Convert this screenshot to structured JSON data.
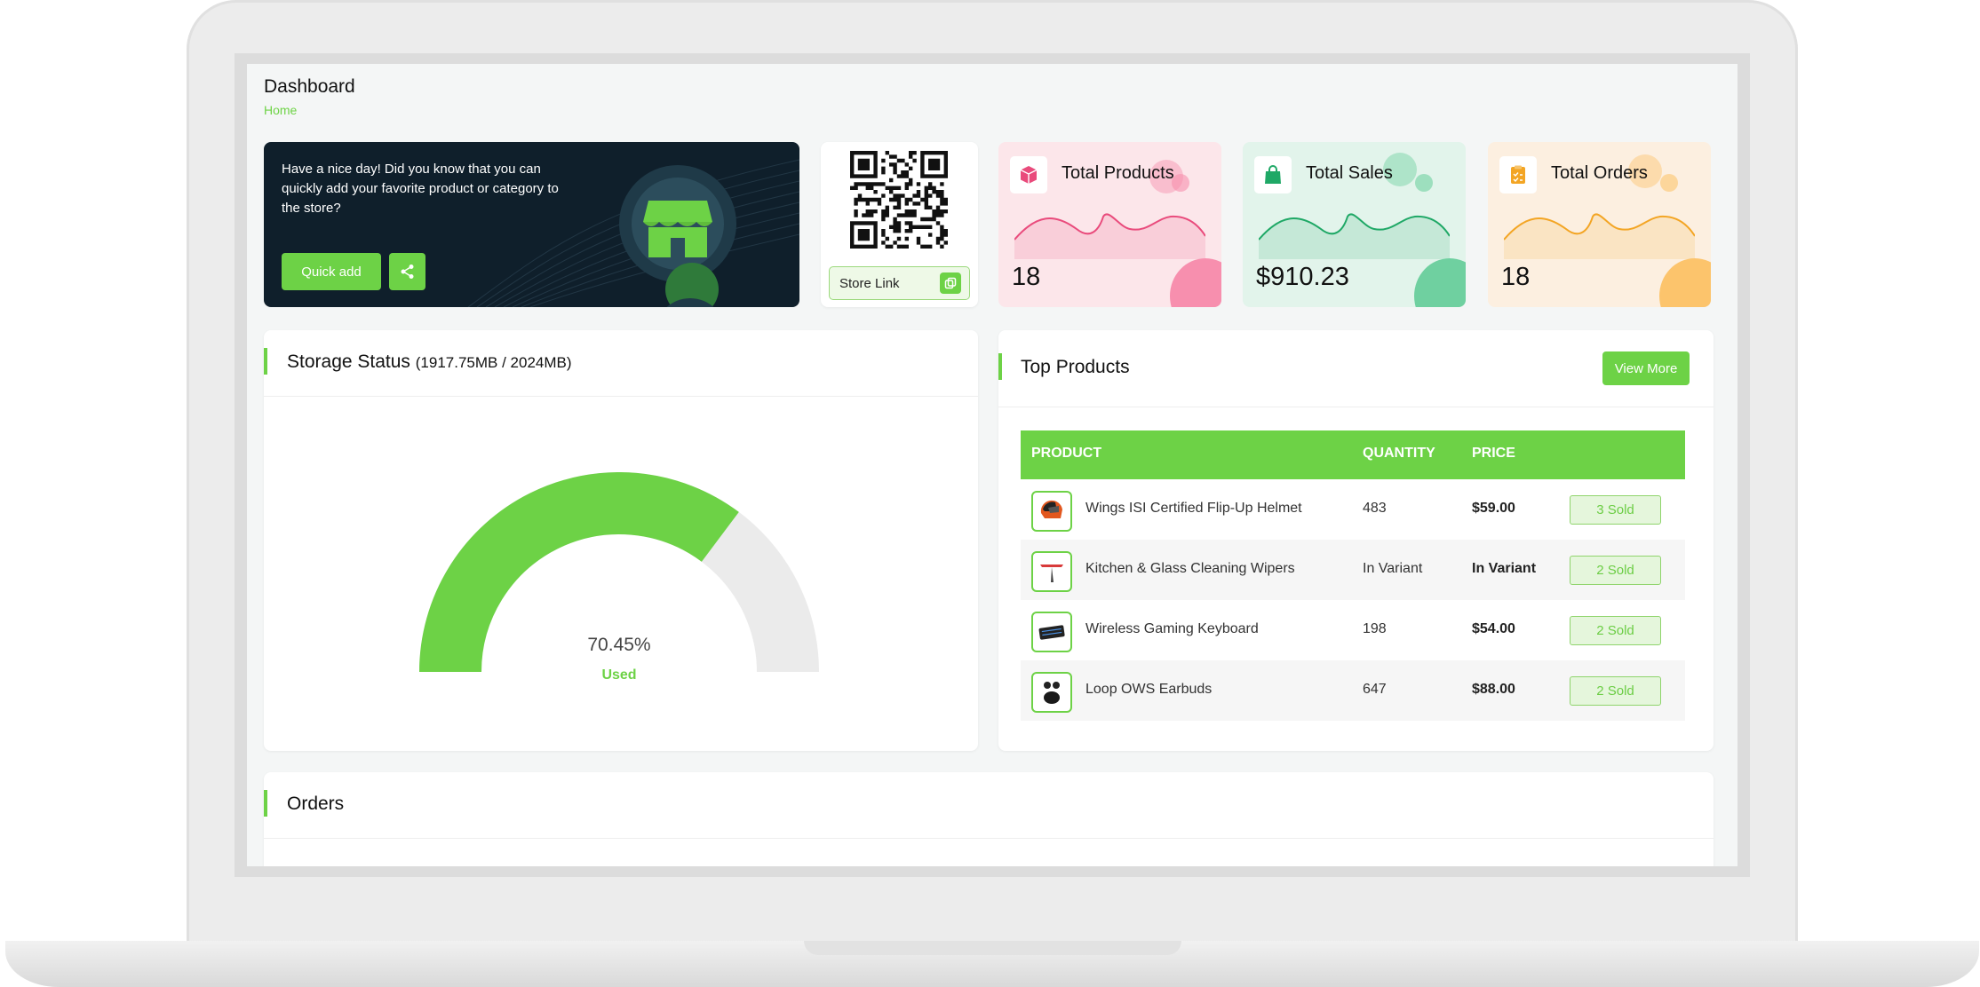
{
  "page": {
    "title": "Dashboard",
    "breadcrumb": "Home"
  },
  "welcome": {
    "message": "Have a nice day! Did you know that you can quickly add your favorite product or category to the store?",
    "quick_add_label": "Quick add",
    "share_icon": "share-icon",
    "illustration_icon": "store-icon"
  },
  "qr": {
    "store_link_label": "Store Link",
    "copy_icon": "copy-icon"
  },
  "stats": [
    {
      "label": "Total Products",
      "value": "18",
      "icon": "box-icon",
      "color": "#e94b7c",
      "bg": "#fce6ea",
      "accent": "#f78fae"
    },
    {
      "label": "Total Sales",
      "value": "$910.23",
      "icon": "shopping-bag-icon",
      "color": "#1fa866",
      "bg": "#e2f4eb",
      "accent": "#6fd0a0"
    },
    {
      "label": "Total Orders",
      "value": "18",
      "icon": "clipboard-icon",
      "color": "#f3a524",
      "bg": "#fcefe0",
      "accent": "#fcc46c"
    }
  ],
  "storage": {
    "title": "Storage Status",
    "detail": "(1917.75MB / 2024MB)",
    "percent_label": "70.45%",
    "used_label": "Used",
    "used_fraction": 0.7045,
    "used_color": "#6dd246",
    "free_color": "#ebebeb"
  },
  "top_products": {
    "title": "Top Products",
    "view_more_label": "View More",
    "columns": [
      "PRODUCT",
      "QUANTITY",
      "PRICE"
    ],
    "rows": [
      {
        "name": "Wings ISI Certified Flip-Up Helmet",
        "quantity": "483",
        "price": "$59.00",
        "sold": "3 Sold",
        "icon": "helmet-icon"
      },
      {
        "name": "Kitchen & Glass Cleaning Wipers",
        "quantity": "In Variant",
        "price": "In Variant",
        "sold": "2 Sold",
        "icon": "wiper-icon"
      },
      {
        "name": "Wireless Gaming Keyboard",
        "quantity": "198",
        "price": "$54.00",
        "sold": "2 Sold",
        "icon": "keyboard-icon"
      },
      {
        "name": "Loop OWS Earbuds",
        "quantity": "647",
        "price": "$88.00",
        "sold": "2 Sold",
        "icon": "earbuds-icon"
      }
    ]
  },
  "orders": {
    "title": "Orders"
  }
}
